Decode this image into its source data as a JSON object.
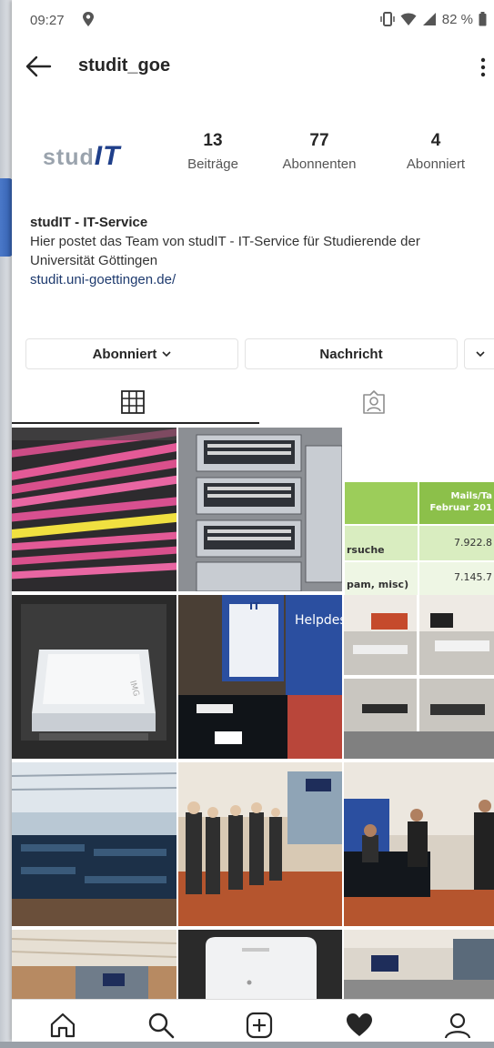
{
  "status_bar": {
    "time": "09:27",
    "battery": "82 %"
  },
  "header": {
    "username": "studit_goe"
  },
  "profile": {
    "logo_text_light": "stud",
    "logo_text_bold": "IT",
    "stats": [
      {
        "number": "13",
        "label": "Beiträge"
      },
      {
        "number": "77",
        "label": "Abonnenten"
      },
      {
        "number": "4",
        "label": "Abonniert"
      }
    ],
    "bio_name": "studIT - IT-Service",
    "bio_text": "Hier postet das Team von studIT - IT-Service für Studierende der Universität Göttingen",
    "bio_link": "studit.uni-goettingen.de/"
  },
  "actions": {
    "following_label": "Abonniert",
    "message_label": "Nachricht"
  },
  "post_table": {
    "header": "Mails/Ta",
    "header2": "Februar 201",
    "row1_label": "rsuche",
    "row1_value": "7.922.8",
    "row2_label": "pam, misc)",
    "row2_value": "7.145.7"
  },
  "helpdesk_sign": {
    "it": "IT",
    "title": "Helpdesk"
  },
  "colors": {
    "link": "#1e3a6e",
    "accent_blue": "#2b4fa0",
    "table_green": "#9ccd5a"
  }
}
